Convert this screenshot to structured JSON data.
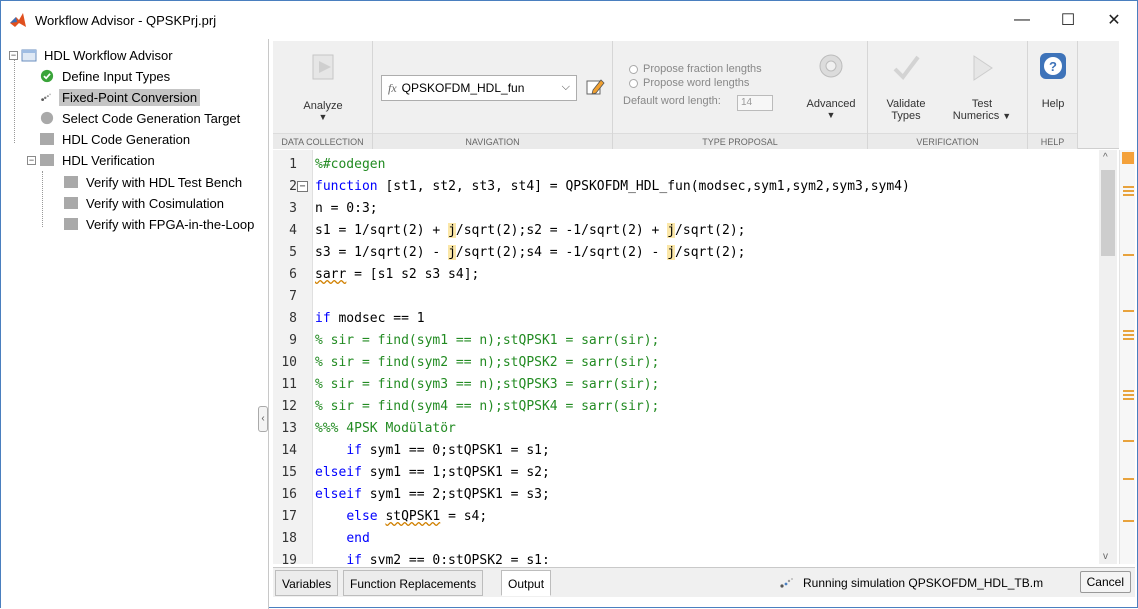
{
  "window": {
    "title": "Workflow Advisor - QPSKPrj.prj",
    "minimize": "—",
    "maximize": "☐",
    "close": "✕"
  },
  "tree": {
    "root": "HDL Workflow Advisor",
    "items": [
      {
        "label": "Define Input Types",
        "icon": "check-circle-icon"
      },
      {
        "label": "Fixed-Point Conversion",
        "icon": "busy-spinner-icon",
        "selected": true
      },
      {
        "label": "Select Code Generation Target",
        "icon": "gray-circle-icon"
      },
      {
        "label": "HDL Code Generation",
        "icon": "gray-square-icon"
      },
      {
        "label": "HDL Verification",
        "icon": "gray-square-icon"
      },
      {
        "label": "Verify with HDL Test Bench",
        "icon": "gray-square-icon"
      },
      {
        "label": "Verify with Cosimulation",
        "icon": "gray-square-icon"
      },
      {
        "label": "Verify with FPGA-in-the-Loop",
        "icon": "gray-square-icon"
      }
    ]
  },
  "toolstrip": {
    "sections": {
      "data_collection": "DATA COLLECTION",
      "navigation": "NAVIGATION",
      "type_proposal": "TYPE PROPOSAL",
      "verification": "VERIFICATION",
      "help": "HELP"
    },
    "analyze": "Analyze",
    "function_select": "QPSKOFDM_HDL_fun",
    "fx": "fx",
    "propose_fraction": "Propose fraction lengths",
    "propose_word": "Propose word lengths",
    "default_word_length_label": "Default word length:",
    "default_word_length_value": "14",
    "advanced": "Advanced",
    "validate_types_1": "Validate",
    "validate_types_2": "Types",
    "test_numerics_1": "Test",
    "test_numerics_2": "Numerics",
    "help": "Help"
  },
  "code": {
    "lines": [
      {
        "n": "1",
        "text": "%#codegen"
      },
      {
        "n": "2",
        "text": "function [st1, st2, st3, st4] = QPSKOFDM_HDL_fun(modsec,sym1,sym2,sym3,sym4)"
      },
      {
        "n": "3",
        "text": "n = 0:3;"
      },
      {
        "n": "4",
        "text": "s1 = 1/sqrt(2) + j/sqrt(2);s2 = -1/sqrt(2) + j/sqrt(2);"
      },
      {
        "n": "5",
        "text": "s3 = 1/sqrt(2) - j/sqrt(2);s4 = -1/sqrt(2) - j/sqrt(2);"
      },
      {
        "n": "6",
        "text": "sarr = [s1 s2 s3 s4];"
      },
      {
        "n": "7",
        "text": ""
      },
      {
        "n": "8",
        "text": "if modsec == 1"
      },
      {
        "n": "9",
        "text": "% sir = find(sym1 == n);stQPSK1 = sarr(sir);"
      },
      {
        "n": "10",
        "text": "% sir = find(sym2 == n);stQPSK2 = sarr(sir);"
      },
      {
        "n": "11",
        "text": "% sir = find(sym3 == n);stQPSK3 = sarr(sir);"
      },
      {
        "n": "12",
        "text": "% sir = find(sym4 == n);stQPSK4 = sarr(sir);"
      },
      {
        "n": "13",
        "text": "%%% 4PSK Modülatör"
      },
      {
        "n": "14",
        "text": "    if sym1 == 0;stQPSK1 = s1;"
      },
      {
        "n": "15",
        "text": "elseif sym1 == 1;stQPSK1 = s2;"
      },
      {
        "n": "16",
        "text": "elseif sym1 == 2;stQPSK1 = s3;"
      },
      {
        "n": "17",
        "text": "    else stQPSK1 = s4;"
      },
      {
        "n": "18",
        "text": "    end"
      },
      {
        "n": "19",
        "text": "    if sym2 == 0;stQPSK2 = s1;"
      }
    ]
  },
  "bottom": {
    "tabs": [
      "Variables",
      "Function Replacements",
      "Output"
    ],
    "active_tab": "Output",
    "status": "Running simulation QPSKOFDM_HDL_TB.m",
    "cancel": "Cancel"
  },
  "colors": {
    "keyword": "#0000ff",
    "comment": "#228b22",
    "highlight": "#fbe7a8",
    "selection": "#c5c5c5"
  }
}
